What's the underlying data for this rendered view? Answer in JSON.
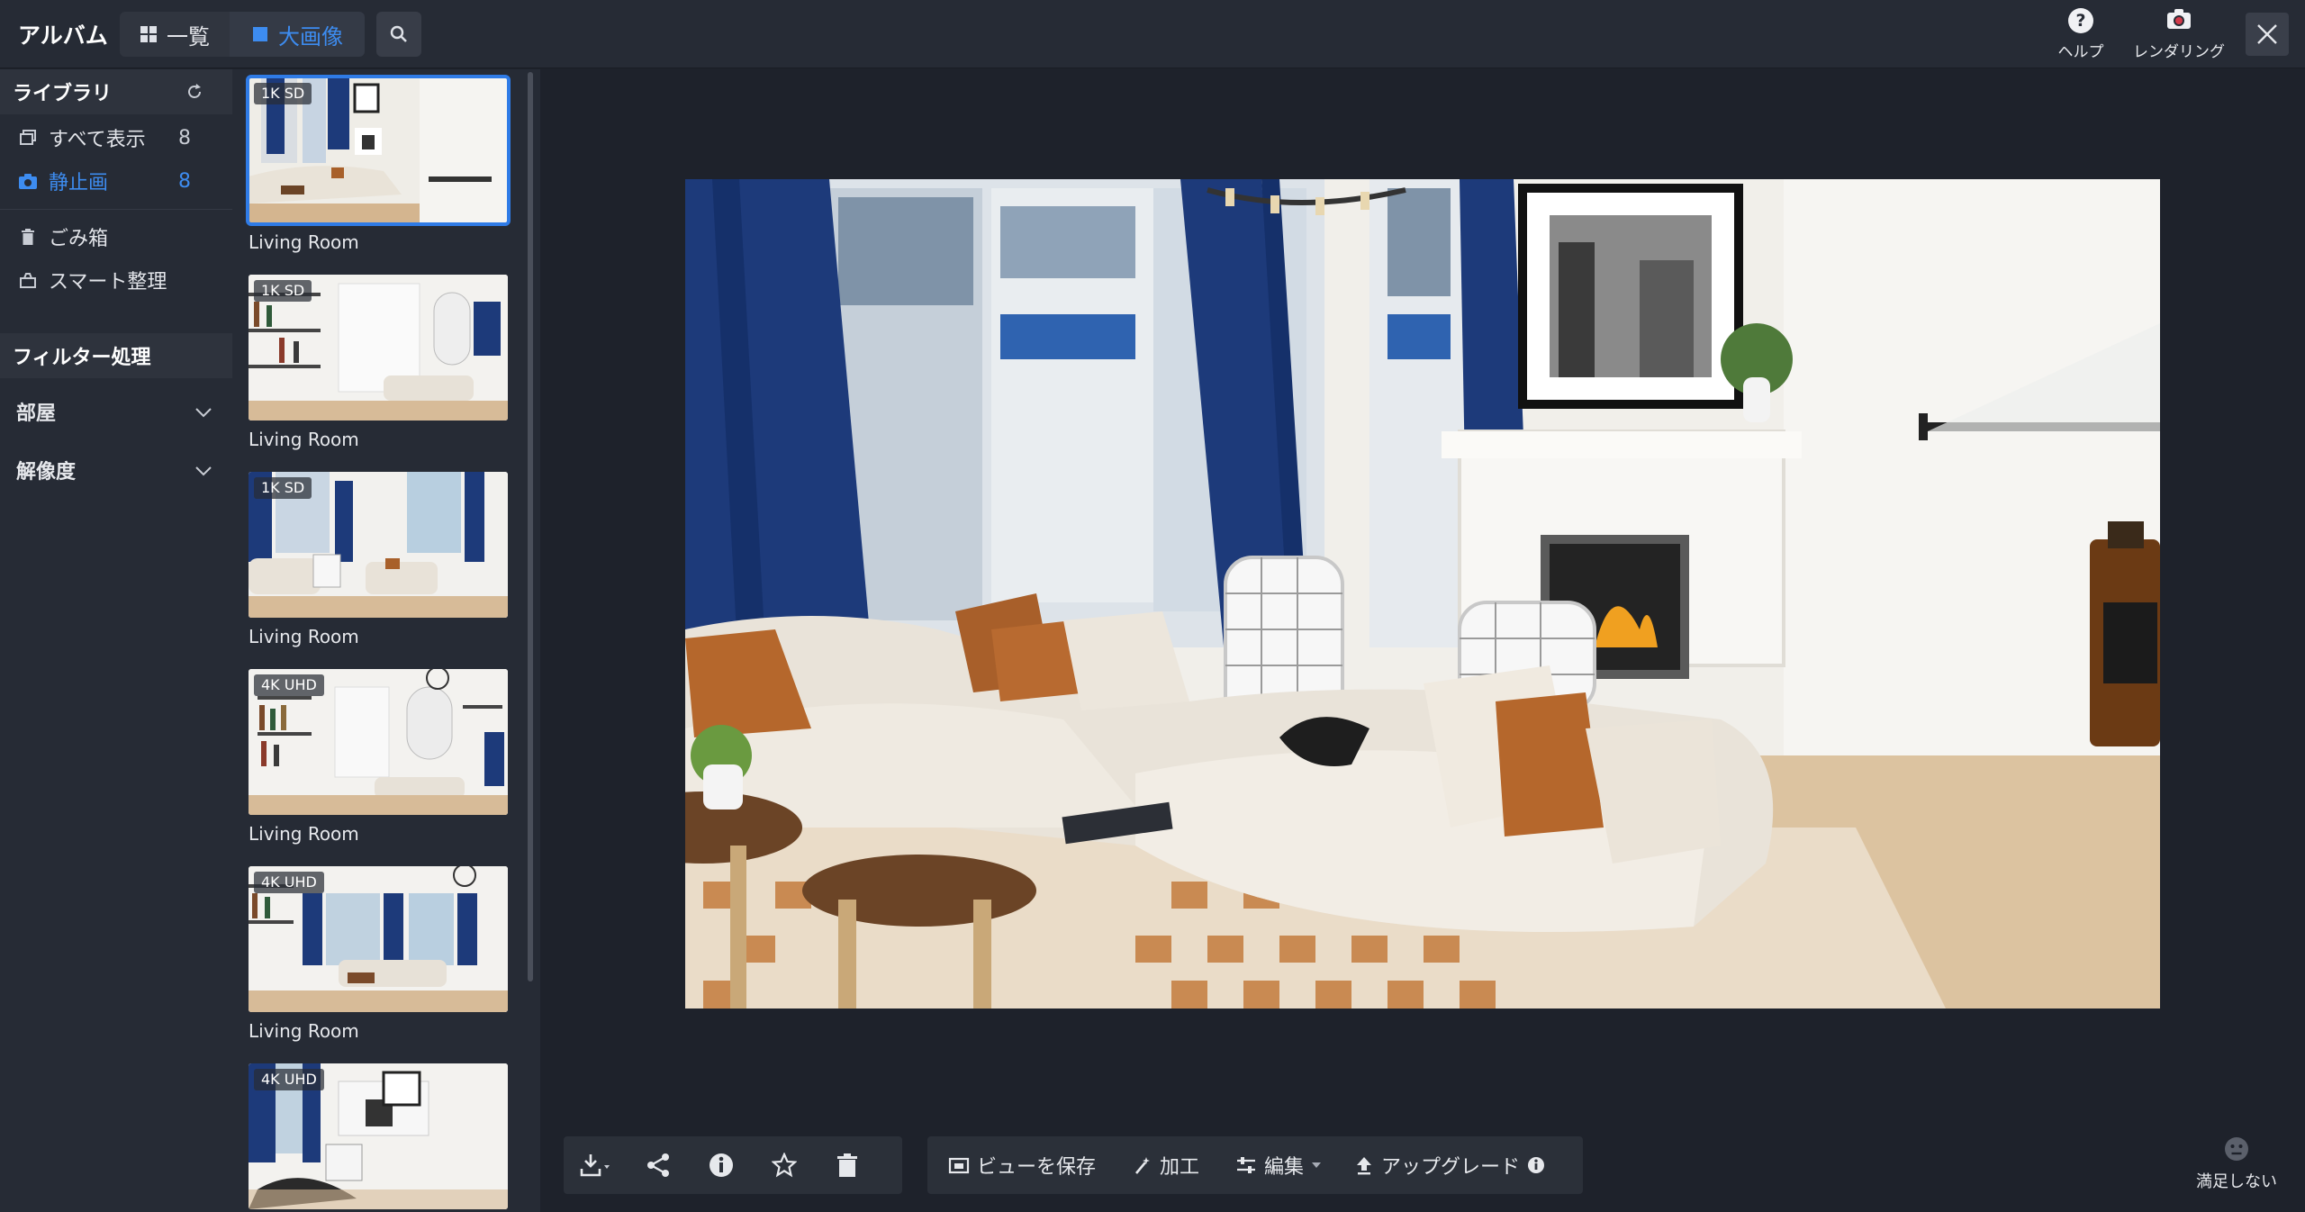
{
  "header": {
    "title": "アルバム",
    "view_list_label": "一覧",
    "view_large_label": "大画像",
    "help_label": "ヘルプ",
    "render_label": "レンダリング"
  },
  "sidebar": {
    "library_heading": "ライブラリ",
    "items": [
      {
        "label": "すべて表示",
        "count": "8",
        "icon": "gallery-icon"
      },
      {
        "label": "静止画",
        "count": "8",
        "icon": "camera-icon",
        "active": true
      },
      {
        "label": "ごみ箱",
        "icon": "trash-icon"
      },
      {
        "label": "スマート整理",
        "icon": "organize-icon"
      }
    ],
    "filter_heading": "フィルター処理",
    "filters": [
      {
        "label": "部屋"
      },
      {
        "label": "解像度"
      }
    ]
  },
  "thumbnails": [
    {
      "badge": "1K SD",
      "label": "Living Room",
      "selected": true
    },
    {
      "badge": "1K SD",
      "label": "Living Room"
    },
    {
      "badge": "1K SD",
      "label": "Living Room"
    },
    {
      "badge": "4K UHD",
      "label": "Living Room"
    },
    {
      "badge": "4K UHD",
      "label": "Living Room"
    },
    {
      "badge": "4K UHD",
      "label": ""
    }
  ],
  "toolbar": {
    "save_view_label": "ビューを保存",
    "process_label": "加工",
    "edit_label": "編集",
    "upgrade_label": "アップグレード"
  },
  "feedback": {
    "label": "満足しない"
  },
  "colors": {
    "accent": "#3d8cf0",
    "background": "#1e222b",
    "panel": "#262b35",
    "curtain": "#1d3a7a"
  }
}
